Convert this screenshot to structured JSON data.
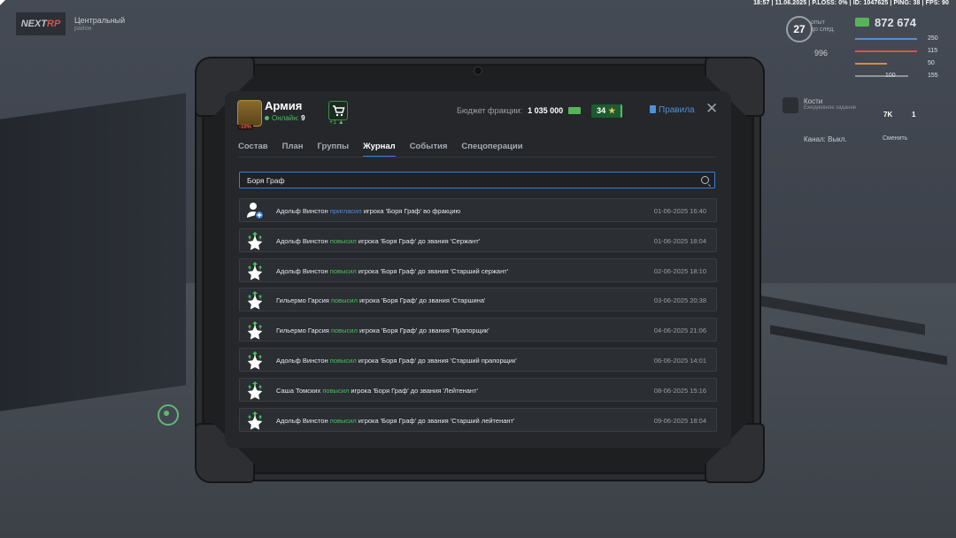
{
  "hud": {
    "topbar": "18:57 | 11.06.2025 | P.LOSS: 0% | ID: 1047625 | PING: 38 | FPS: 90",
    "logo_left": "NEXT",
    "logo_right": "RP",
    "location_title": "Центральный",
    "location_sub": "район",
    "level": "27",
    "level_sub1": "опыт",
    "level_sub2": "до след.",
    "money": "872 674",
    "wanted": "996",
    "stat_health": "250",
    "stat_armor": "115",
    "stat_hunger": "50",
    "stat_ammo_a": "100",
    "stat_ammo_b": "155",
    "bones_title": "Кости",
    "bones_sub": "Ежедневное задание",
    "bones_count_a": "7K",
    "bones_count_b": "1",
    "channel": "Канал: Выкл.",
    "channel_action": "Сменить"
  },
  "panel": {
    "faction_name": "Армия",
    "online_label": "Онлайн:",
    "online_count": "9",
    "badge_pct": "-10%",
    "shop_plus": "+1",
    "budget_label": "Бюджет фракции:",
    "budget_value": "1 035 000",
    "stars_value": "34",
    "star_symbol": "★",
    "rules_label": "Правила",
    "close_symbol": "✕"
  },
  "tabs": [
    "Состав",
    "План",
    "Группы",
    "Журнал",
    "События",
    "Спецоперации"
  ],
  "active_tab": "Журнал",
  "search": {
    "value": "Боря Граф"
  },
  "log": [
    {
      "type": "invite",
      "actor": "Адольф Винстон",
      "verb": "пригласил",
      "text": " игрока 'Боря Граф' во фракцию",
      "date": "01-06-2025 16:40"
    },
    {
      "type": "promote",
      "actor": "Адольф Винстон",
      "verb": "повысил",
      "text": " игрока 'Боря Граф' до звания 'Сержант'",
      "date": "01-06-2025 18:04"
    },
    {
      "type": "promote",
      "actor": "Адольф Винстон",
      "verb": "повысил",
      "text": " игрока 'Боря Граф' до звания 'Старший сержант'",
      "date": "02-06-2025 18:10"
    },
    {
      "type": "promote",
      "actor": "Гильермо Гарсия",
      "verb": "повысил",
      "text": " игрока 'Боря Граф' до звания 'Старшина'",
      "date": "03-06-2025 20:38"
    },
    {
      "type": "promote",
      "actor": "Гильермо Гарсия",
      "verb": "повысил",
      "text": " игрока 'Боря Граф' до звания 'Прапорщик'",
      "date": "04-06-2025 21:06"
    },
    {
      "type": "promote",
      "actor": "Адольф Винстон",
      "verb": "повысил",
      "text": " игрока 'Боря Граф' до звания 'Старший прапорщик'",
      "date": "06-06-2025 14:01"
    },
    {
      "type": "promote",
      "actor": "Саша Томских",
      "verb": "повысил",
      "text": " игрока 'Боря Граф' до звания 'Лейтенант'",
      "date": "08-06-2025 15:16"
    },
    {
      "type": "promote",
      "actor": "Адольф Винстон",
      "verb": "повысил",
      "text": " игрока 'Боря Граф' до звания 'Старший лейтенант'",
      "date": "09-06-2025 18:04"
    }
  ],
  "colors": {
    "accent_blue": "#3d7fd6",
    "link_blue": "#4f8fd9",
    "green": "#4fbf62",
    "date_gray": "#9aa0a6"
  },
  "icons": {
    "invite": "user-add-icon",
    "promote": "rank-up-star-icon",
    "search": "search-icon",
    "close": "close-icon",
    "shop": "cart-icon",
    "rules": "document-icon",
    "cash": "cash-icon"
  }
}
